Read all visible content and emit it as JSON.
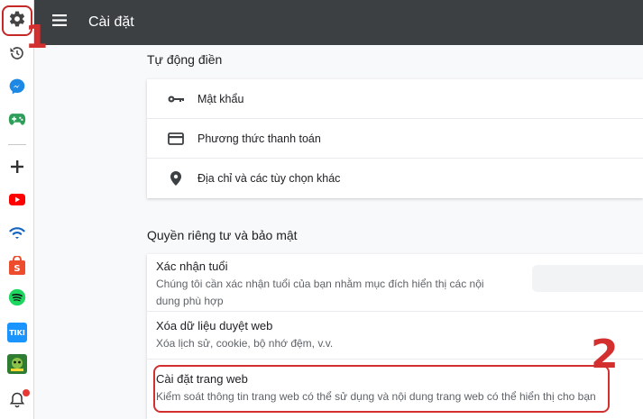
{
  "header": {
    "title": "Cài đặt"
  },
  "annotations": {
    "marker_1": "1",
    "marker_2": "2"
  },
  "sidebar": {
    "items": [
      {
        "icon": "gear-icon",
        "selected": true
      },
      {
        "icon": "history-icon"
      },
      {
        "icon": "messenger-icon"
      },
      {
        "icon": "game-controller-icon"
      },
      {
        "icon": "add-icon"
      },
      {
        "icon": "youtube-icon"
      },
      {
        "icon": "wifi-icon"
      },
      {
        "icon": "shopee-icon"
      },
      {
        "icon": "spotify-icon"
      },
      {
        "icon": "tiki-icon",
        "label": "TIKI"
      },
      {
        "icon": "game-app-icon"
      },
      {
        "icon": "notification-bell-icon",
        "badge": true
      }
    ]
  },
  "autofill": {
    "title": "Tự động điền",
    "items": [
      {
        "icon": "key-icon",
        "label": "Mật khẩu"
      },
      {
        "icon": "credit-card-icon",
        "label": "Phương thức thanh toán"
      },
      {
        "icon": "location-pin-icon",
        "label": "Địa chỉ và các tùy chọn khác"
      }
    ]
  },
  "privacy": {
    "title": "Quyền riêng tư và bảo mật",
    "items": [
      {
        "title": "Xác nhận tuổi",
        "subtitle_line1": "Chúng tôi cần xác nhận tuổi của bạn nhằm mục đích hiển thị các nội",
        "subtitle_line2": "dung phù hợp"
      },
      {
        "title": "Xóa dữ liệu duyệt web",
        "subtitle": "Xóa lịch sử, cookie, bộ nhớ đệm, v.v."
      },
      {
        "title": "Cài đặt trang web",
        "subtitle": "Kiểm soát thông tin trang web có thể sử dụng và nội dung trang web có thể hiển thị cho bạn"
      }
    ]
  },
  "colors": {
    "header_bg": "#3c4043",
    "highlight": "#d32f2f",
    "page_bg": "#f8f9fa"
  }
}
